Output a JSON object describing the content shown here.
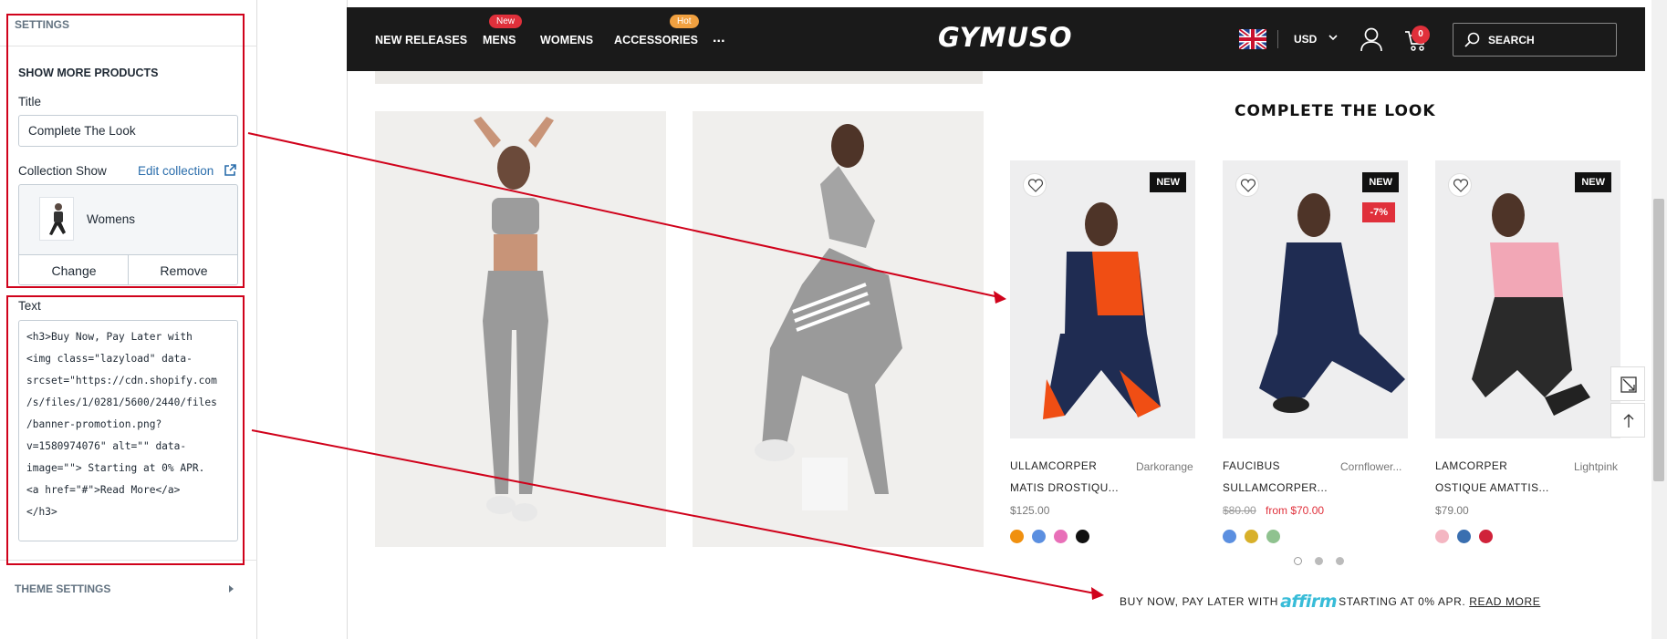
{
  "panel": {
    "section_title": "SETTINGS",
    "block_title": "SHOW MORE PRODUCTS",
    "title_label": "Title",
    "title_value": "Complete The Look",
    "collection_label": "Collection Show",
    "edit_collection": "Edit collection",
    "collection_name": "Womens",
    "change_label": "Change",
    "remove_label": "Remove",
    "text_label": "Text",
    "text_lines": [
      "<h3>Buy Now, Pay Later with",
      "<img class=\"lazyload\" data-",
      "srcset=\"https://cdn.shopify.com",
      "/s/files/1/0281/5600/2440/files",
      "/banner-promotion.png?",
      "v=1580974076\" alt=\"\" data-",
      "image=\"\"> Starting at 0% APR.",
      "<a href=\"#\">Read More</a>",
      "</h3>"
    ],
    "theme_settings": "THEME SETTINGS"
  },
  "store": {
    "nav": [
      "NEW RELEASES",
      "MENS",
      "WOMENS",
      "ACCESSORIES",
      "..."
    ],
    "badge_new": "New",
    "badge_hot": "Hot",
    "logo": "GYMUSO",
    "currency": "USD",
    "cart_count": "0",
    "search_placeholder": "SEARCH"
  },
  "section_title": "COMPLETE THE LOOK",
  "products": [
    {
      "name1": "ULLAMCORPER",
      "name2": "MATIS DROSTIQU...",
      "color": "Darkorange",
      "price": "$125.00",
      "badge": "NEW",
      "swatches": [
        "#f0900f",
        "#5b8fe0",
        "#e86fb8",
        "#111111"
      ]
    },
    {
      "name1": "FAUCIBUS",
      "name2": "SULLAMCORPER...",
      "color": "Cornflower...",
      "price_old": "$80.00",
      "price_sale": "from $70.00",
      "badge": "NEW",
      "sale": "-7%",
      "swatches": [
        "#5b8fe0",
        "#d8b02a",
        "#8fc28f"
      ]
    },
    {
      "name1": "LAMCORPER",
      "name2": "OSTIQUE AMATTIS...",
      "color": "Lightpink",
      "price": "$79.00",
      "badge": "NEW",
      "swatches": [
        "#f4b6c2",
        "#3a6fb0",
        "#d0223a"
      ]
    }
  ],
  "promo": {
    "before": "BUY NOW, PAY LATER WITH",
    "logo": "affirm",
    "after": "STARTING AT 0% APR.",
    "read_more": "READ MORE"
  },
  "colors": {
    "annotation": "#d0021b",
    "nav_bg": "#1a1a1a",
    "sale": "#e0303b",
    "link": "#2a6dab"
  }
}
